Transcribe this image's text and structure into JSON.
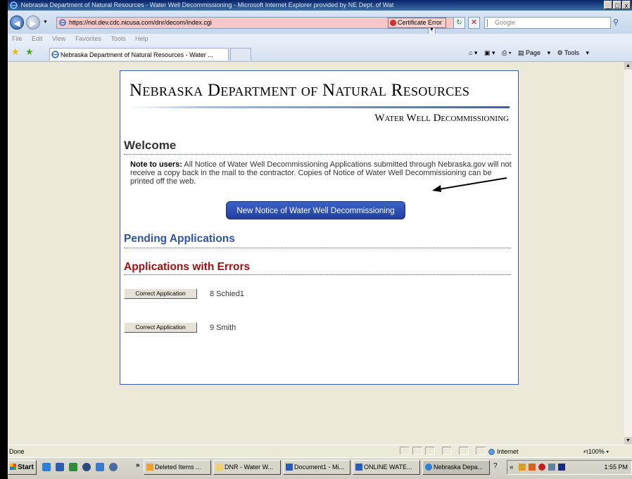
{
  "window": {
    "title": "Nebraska Department of Natural Resources - Water Well Decommissioning - Microsoft Internet Explorer provided by NE Dept. of Wat",
    "min": "_",
    "max": "□",
    "close": "x"
  },
  "addressbar": {
    "url": "https://nol.dev.cdc.nicusa.com/dnr/decom/index.cgi",
    "certificate_error": "Certificate Error",
    "search_placeholder": "Google"
  },
  "menu": [
    "File",
    "Edit",
    "View",
    "Favorites",
    "Tools",
    "Help"
  ],
  "tab": {
    "title": "Nebraska Department of Natural Resources - Water ..."
  },
  "commandbar": {
    "page_label": "Page",
    "tools_label": "Tools"
  },
  "page": {
    "title": "Nebraska Department of Natural Resources",
    "subtitle": "Water Well Decommissioning",
    "welcome_heading": "Welcome",
    "note_label": "Note to users:",
    "note_text": "All Notice of Water Well Decommissioning Applications submitted through Nebraska.gov will not receive a copy back in the mail to the contractor. Copies of Notice of Water Well Decommissioning can be printed off the web.",
    "new_notice_button": "New Notice of Water Well Decommissioning",
    "pending_heading": "Pending Applications",
    "errors_heading": "Applications with Errors",
    "error_apps": [
      {
        "button": "Correct Application",
        "name": "8 Schied1"
      },
      {
        "button": "Correct Application",
        "name": "9 Smith"
      }
    ]
  },
  "statusbar": {
    "status": "Done",
    "zone": "Internet",
    "zoom": "ન100%"
  },
  "taskbar": {
    "start": "Start",
    "chevron": "»",
    "tasks": [
      "Deleted Items ...",
      "DNR - Water W...",
      "Document1 - Mi...",
      "ONLINE WATE...",
      "Nebraska Depa..."
    ],
    "clock": "1:55 PM"
  },
  "colors": {
    "title_blue": "#0a246a",
    "heading_blue": "#2e53a8",
    "error_red": "#a01010",
    "button_blue": "#2a4ab0"
  }
}
